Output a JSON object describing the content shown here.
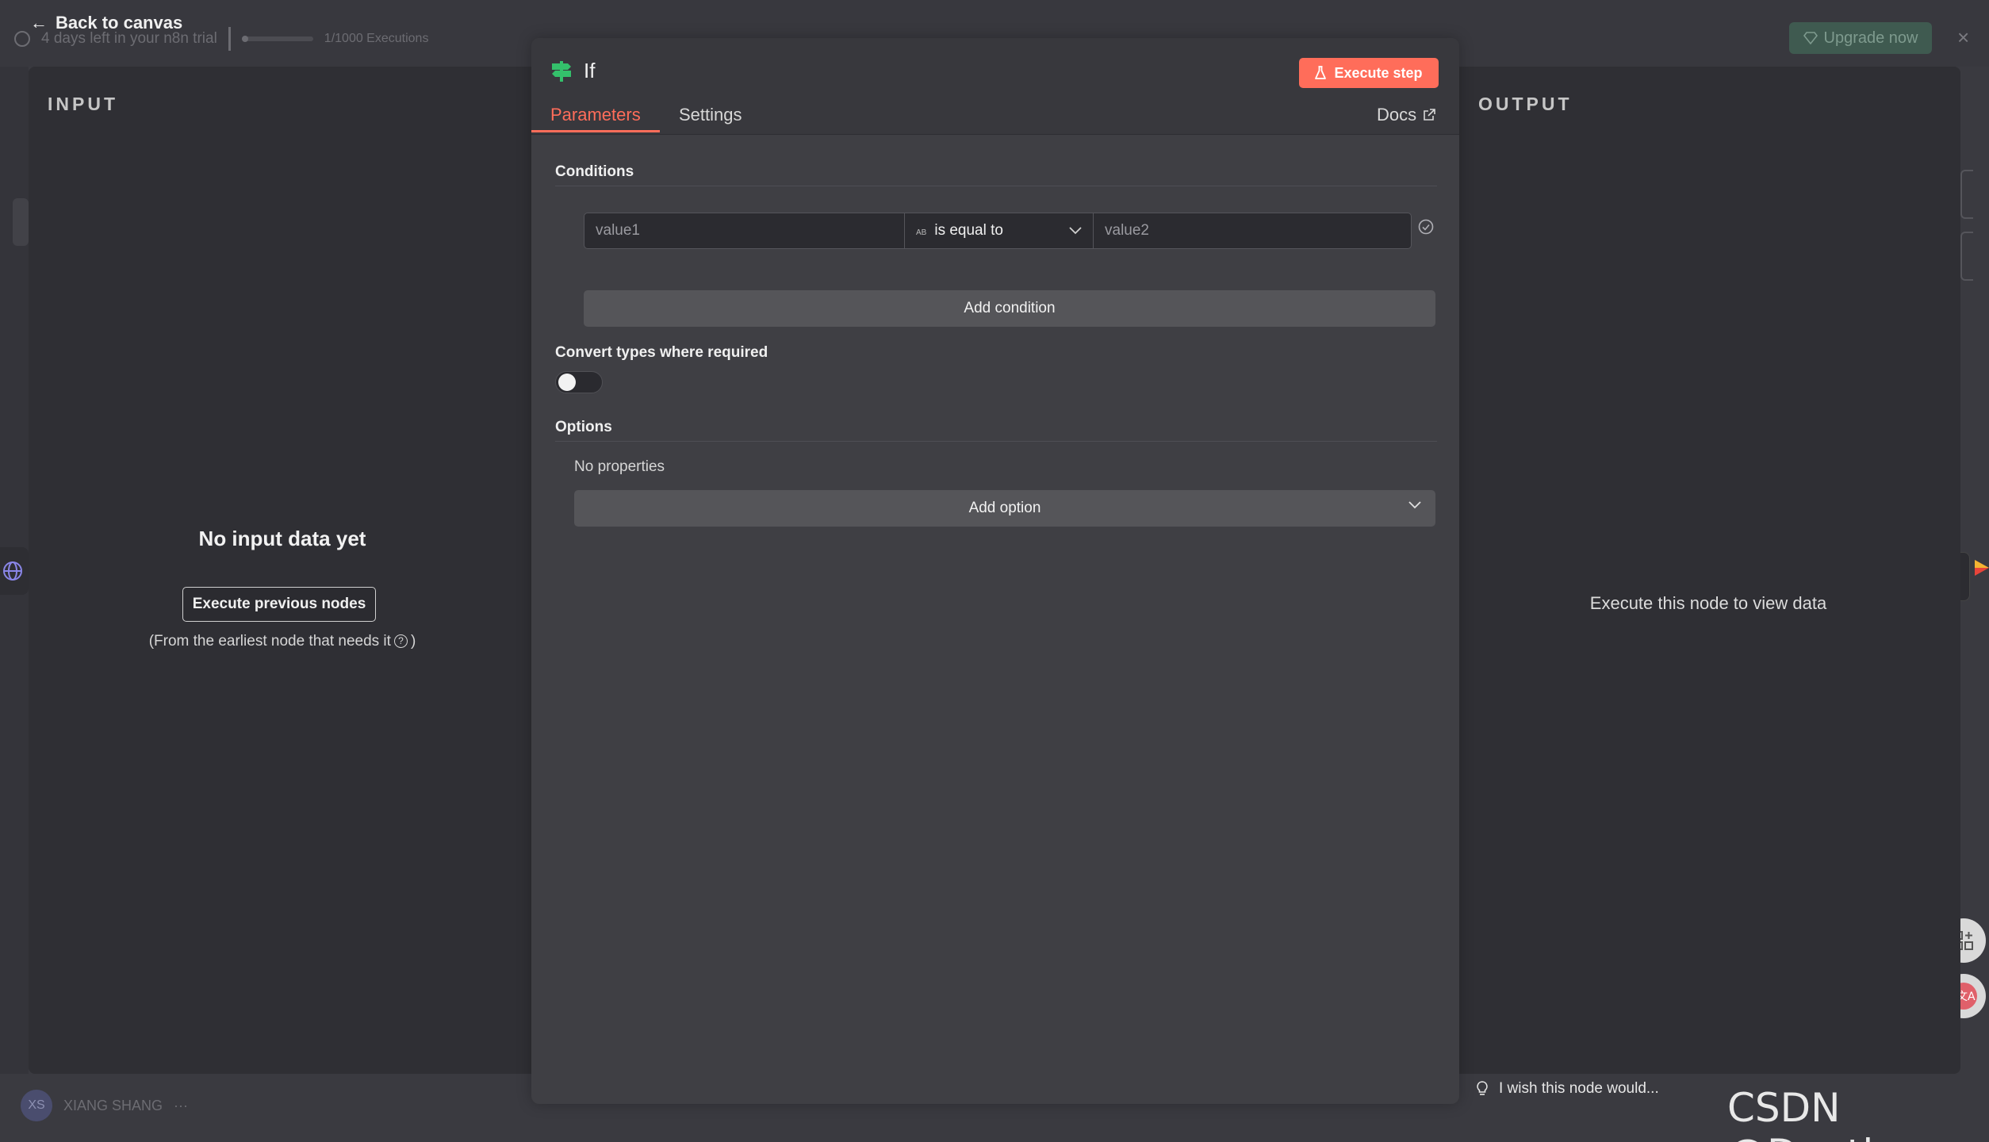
{
  "header": {
    "back_label": "Back to canvas",
    "trial_text": "4 days left in your n8n trial",
    "executions": "1/1000 Executions",
    "upgrade_label": "Upgrade now"
  },
  "user": {
    "initials": "XS",
    "name": "XIANG SHANG",
    "menu": "···"
  },
  "input_panel": {
    "label": "INPUT",
    "empty_title": "No input data yet",
    "execute_prev_label": "Execute previous nodes",
    "note_prefix": "(From the earliest node that needs it",
    "note_suffix": ")"
  },
  "output_panel": {
    "label": "OUTPUT",
    "empty_message": "Execute this node to view data",
    "feedback_label": "I wish this node would..."
  },
  "node": {
    "title": "If",
    "execute_step_label": "Execute step",
    "tabs": [
      {
        "label": "Parameters",
        "active": true
      },
      {
        "label": "Settings",
        "active": false
      }
    ],
    "docs_label": "Docs"
  },
  "conditions": {
    "title": "Conditions",
    "value1_placeholder": "value1",
    "type_badge": "AB",
    "operator": "is equal to",
    "value2_placeholder": "value2",
    "add_condition_label": "Add condition"
  },
  "convert_types": {
    "label": "Convert types where required",
    "enabled": false
  },
  "options": {
    "title": "Options",
    "empty_text": "No properties",
    "add_option_label": "Add option"
  },
  "colors": {
    "accent": "#ff6d5a",
    "node_icon": "#34c06b",
    "upgrade_bg": "#3f5a50"
  },
  "watermark": "CSDN @Dontla"
}
